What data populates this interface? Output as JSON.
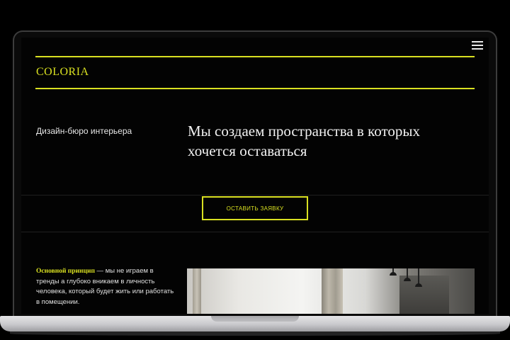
{
  "site": {
    "logo": "COLORIA",
    "tagline": "Дизайн-бюро интерьера",
    "headline": "Мы создаем пространства в которых хочется оставаться",
    "cta_label": "ОСТАВИТЬ ЗАЯВКУ",
    "principle": {
      "accent": "Основной принцип",
      "text": " — мы не играем в тренды а глубоко вникаем в личность человека, который будет жить или работать в помещении."
    }
  },
  "icons": {
    "menu": "hamburger-menu-icon"
  },
  "colors": {
    "accent": "#d9e021",
    "background": "#030303",
    "text": "#f2f2f2"
  }
}
